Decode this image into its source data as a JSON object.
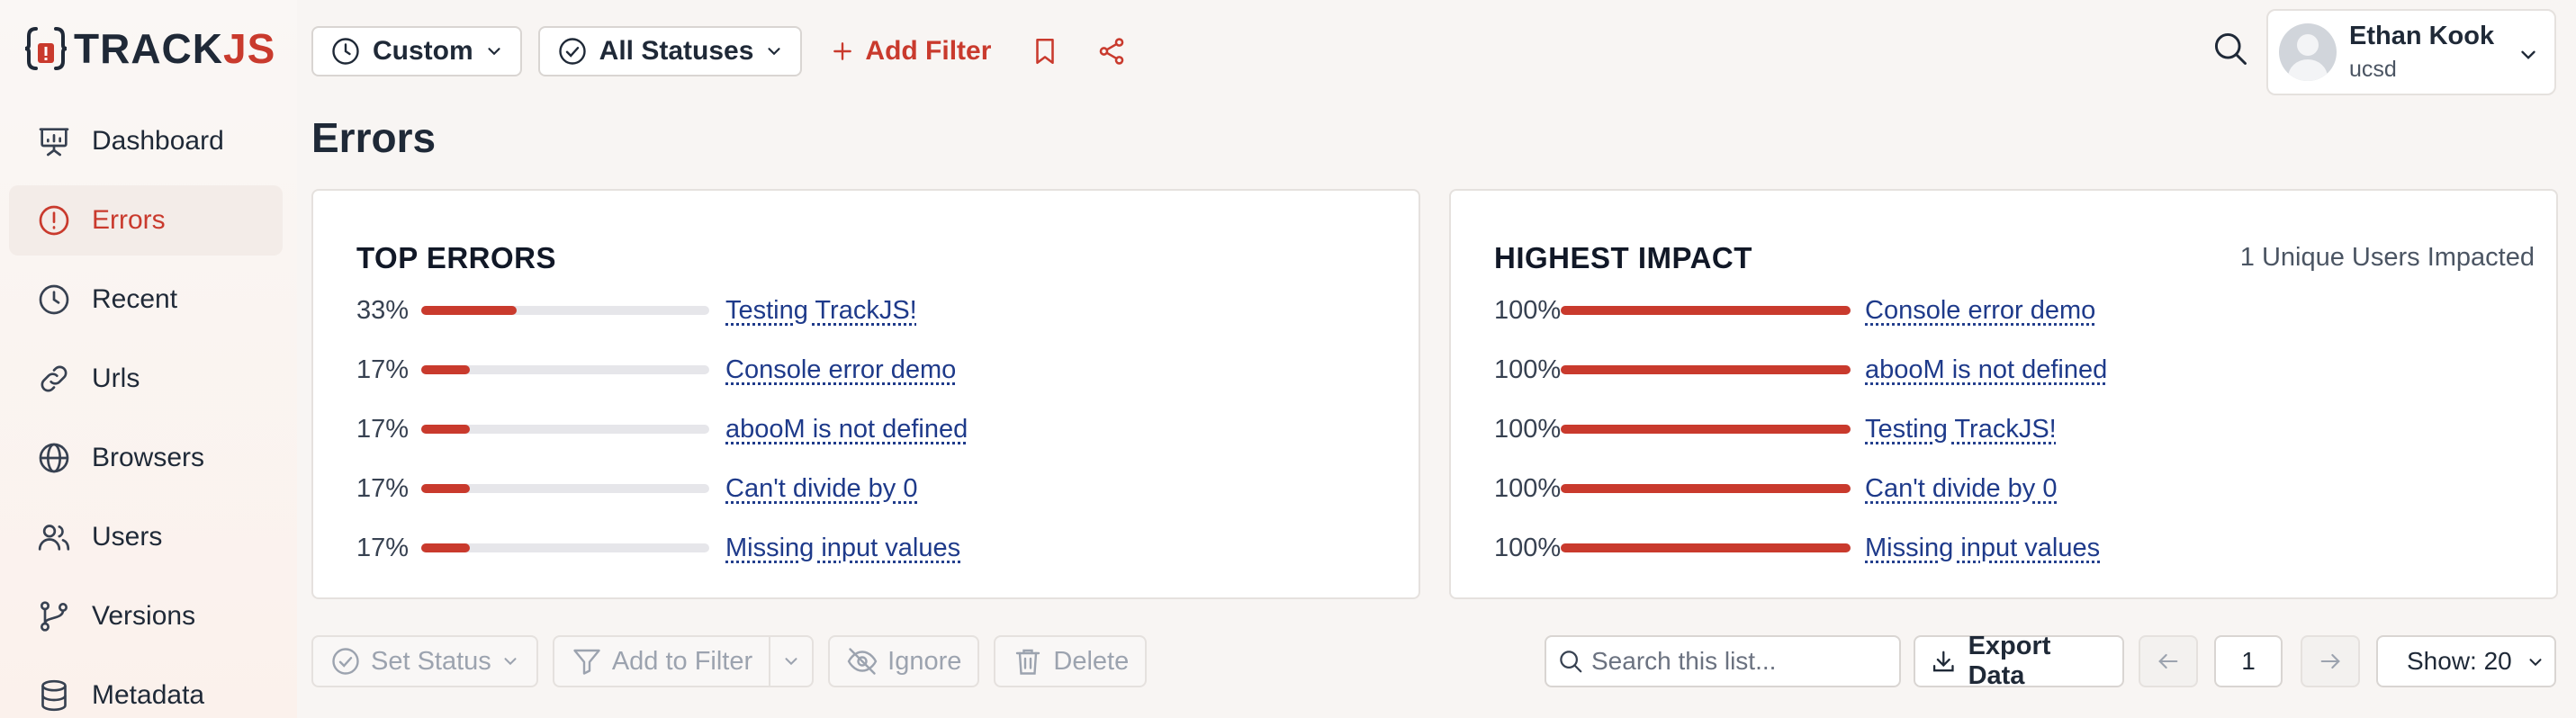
{
  "app": {
    "logo_track": "TRACK",
    "logo_js": "JS"
  },
  "sidebar": {
    "items": [
      {
        "label": "Dashboard",
        "icon": "presentation-chart-icon",
        "active": false
      },
      {
        "label": "Errors",
        "icon": "alert-circle-icon",
        "active": true
      },
      {
        "label": "Recent",
        "icon": "clock-icon",
        "active": false
      },
      {
        "label": "Urls",
        "icon": "link-icon",
        "active": false
      },
      {
        "label": "Browsers",
        "icon": "globe-icon",
        "active": false
      },
      {
        "label": "Users",
        "icon": "users-icon",
        "active": false
      },
      {
        "label": "Versions",
        "icon": "git-branch-icon",
        "active": false
      },
      {
        "label": "Metadata",
        "icon": "database-icon",
        "active": false
      }
    ]
  },
  "toolbar": {
    "date_range": "Custom",
    "status": "All Statuses",
    "add_filter": "Add Filter"
  },
  "user": {
    "name": "Ethan Kook",
    "org": "ucsd"
  },
  "page": {
    "title": "Errors"
  },
  "top_errors": {
    "title": "TOP ERRORS",
    "rows": [
      {
        "pct": "33%",
        "fraction": 0.33,
        "label": "Testing TrackJS!"
      },
      {
        "pct": "17%",
        "fraction": 0.17,
        "label": "Console error demo"
      },
      {
        "pct": "17%",
        "fraction": 0.17,
        "label": "abooM is not defined"
      },
      {
        "pct": "17%",
        "fraction": 0.17,
        "label": "Can't divide by 0"
      },
      {
        "pct": "17%",
        "fraction": 0.17,
        "label": "Missing input values"
      }
    ]
  },
  "highest_impact": {
    "title": "HIGHEST IMPACT",
    "subtitle": "1 Unique Users Impacted",
    "rows": [
      {
        "pct": "100%",
        "fraction": 1.0,
        "label": "Console error demo"
      },
      {
        "pct": "100%",
        "fraction": 1.0,
        "label": "abooM is not defined"
      },
      {
        "pct": "100%",
        "fraction": 1.0,
        "label": "Testing TrackJS!"
      },
      {
        "pct": "100%",
        "fraction": 1.0,
        "label": "Can't divide by 0"
      },
      {
        "pct": "100%",
        "fraction": 1.0,
        "label": "Missing input values"
      }
    ]
  },
  "actions": {
    "set_status": "Set Status",
    "add_to_filter": "Add to Filter",
    "ignore": "Ignore",
    "delete": "Delete",
    "search_placeholder": "Search this list...",
    "export": "Export Data",
    "page": "1",
    "show": "Show: 20"
  },
  "colors": {
    "accent": "#c93a2d",
    "link": "#1e3a8a"
  }
}
